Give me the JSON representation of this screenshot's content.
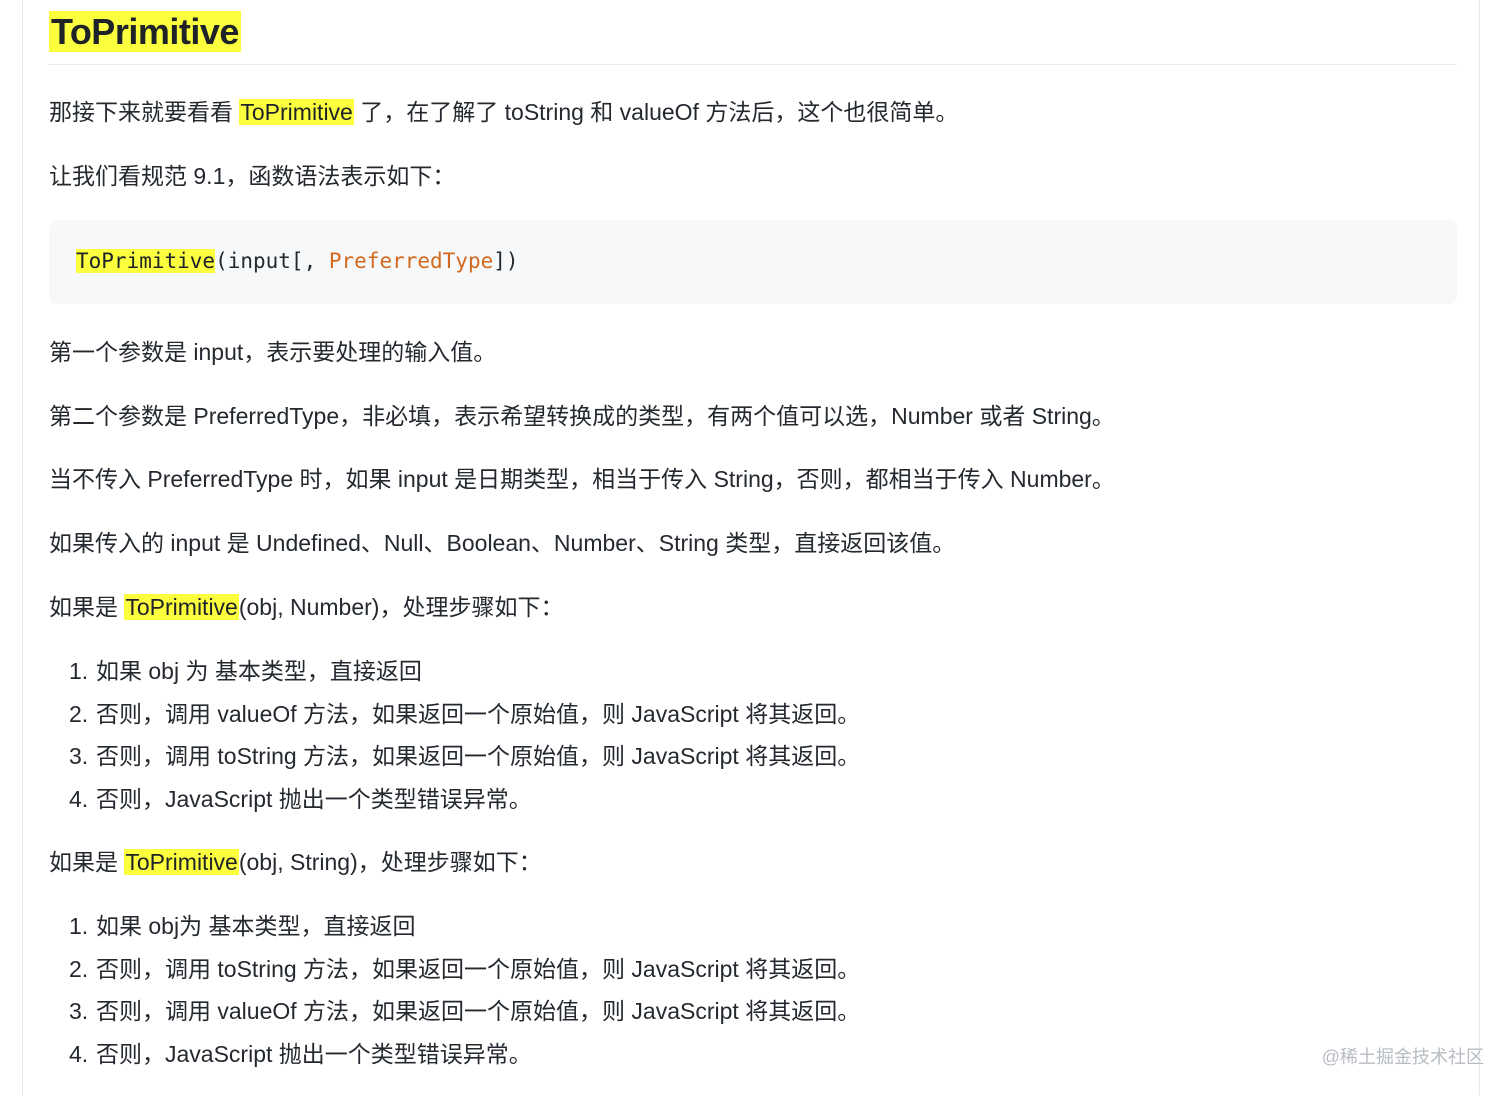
{
  "heading": "ToPrimitive",
  "intro": {
    "pre": "那接下来就要看看 ",
    "highlight": "ToPrimitive",
    "post": " 了，在了解了 toString 和 valueOf 方法后，这个也很简单。"
  },
  "spec_line": "让我们看规范 9.1，函数语法表示如下：",
  "code": {
    "fn": "ToPrimitive",
    "open": "(input[, ",
    "param": "PreferredType",
    "close": "])"
  },
  "param1": "第一个参数是 input，表示要处理的输入值。",
  "param2": "第二个参数是 PreferredType，非必填，表示希望转换成的类型，有两个值可以选，Number 或者 String。",
  "default_rule": "当不传入 PreferredType 时，如果 input 是日期类型，相当于传入 String，否则，都相当于传入 Number。",
  "primitive_rule": "如果传入的 input 是 Undefined、Null、Boolean、Number、String 类型，直接返回该值。",
  "number_case": {
    "pre": "如果是 ",
    "highlight": "ToPrimitive",
    "post": "(obj, Number)，处理步骤如下："
  },
  "number_steps": [
    {
      "num": "1.",
      "text": "如果 obj 为 基本类型，直接返回"
    },
    {
      "num": "2.",
      "text": "否则，调用 valueOf 方法，如果返回一个原始值，则 JavaScript 将其返回。"
    },
    {
      "num": "3.",
      "text": "否则，调用 toString 方法，如果返回一个原始值，则 JavaScript 将其返回。"
    },
    {
      "num": "4.",
      "text": "否则，JavaScript 抛出一个类型错误异常。"
    }
  ],
  "string_case": {
    "pre": "如果是 ",
    "highlight": "ToPrimitive",
    "post": "(obj, String)，处理步骤如下："
  },
  "string_steps": [
    {
      "num": "1.",
      "text": "如果 obj为 基本类型，直接返回"
    },
    {
      "num": "2.",
      "text": "否则，调用 toString 方法，如果返回一个原始值，则 JavaScript 将其返回。"
    },
    {
      "num": "3.",
      "text": "否则，调用 valueOf 方法，如果返回一个原始值，则 JavaScript 将其返回。"
    },
    {
      "num": "4.",
      "text": "否则，JavaScript 抛出一个类型错误异常。"
    }
  ],
  "watermark": "@稀土掘金技术社区",
  "colors": {
    "highlight": "#fbff3e",
    "code_bg": "#f6f8fa",
    "code_param": "#d2691e",
    "text": "#24292f"
  }
}
